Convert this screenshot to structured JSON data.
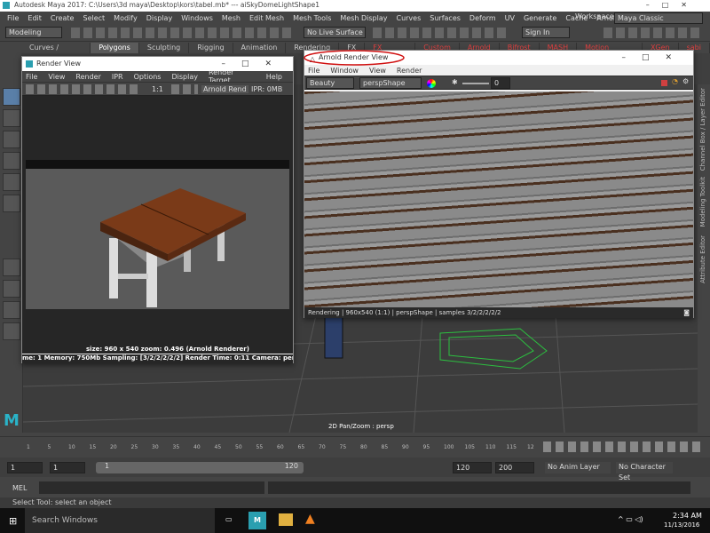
{
  "title_bar": {
    "title": "Autodesk Maya 2017: C:\\Users\\3d maya\\Desktop\\kors\\tabel.mb*    ---    aiSkyDomeLightShape1"
  },
  "menu": [
    "File",
    "Edit",
    "Create",
    "Select",
    "Modify",
    "Display",
    "Windows",
    "Mesh",
    "Edit Mesh",
    "Mesh Tools",
    "Mesh Display",
    "Curves",
    "Surfaces",
    "Deform",
    "UV",
    "Generate",
    "Cache",
    "Arnold",
    "Help"
  ],
  "workspace": {
    "label": "Workspace :",
    "value": "Maya Classic"
  },
  "status_line": {
    "mode": "Modeling",
    "live_surface": "No Live Surface",
    "sign_in": "Sign In"
  },
  "shelf_tabs": [
    "Curves / Surfaces",
    "Polygons",
    "Sculpting",
    "Rigging",
    "Animation",
    "Rendering",
    "FX",
    "FX Caching",
    "Custom",
    "Arnold",
    "Bifrost",
    "MASH",
    "Motion Graphics",
    "XGen",
    "sabi"
  ],
  "render_view": {
    "title": "Render View",
    "menu": [
      "File",
      "View",
      "Render",
      "IPR",
      "Options",
      "Display",
      "Render Target",
      "Help"
    ],
    "toolbar": {
      "ratio": "1:1",
      "renderer": "Arnold Rend",
      "ipr": "IPR: 0MB"
    },
    "size_text": "size: 960 x 540  zoom: 0.496      (Arnold Renderer)",
    "stats": "me: 1    Memory: 750Mb    Sampling: [3/2/2/2/2/2]    Render Time: 0:11    Camera: perspShape"
  },
  "arnold_view": {
    "title": "Arnold Render View",
    "menu": [
      "File",
      "Window",
      "View",
      "Render"
    ],
    "aov": "Beauty",
    "camera": "perspShape",
    "exposure": "0",
    "status": "Rendering | 960x540 (1:1) | perspShape | samples 3/2/2/2/2/2"
  },
  "viewport": {
    "hud": "2D Pan/Zoom : persp"
  },
  "right_tabs": [
    "Channel Box / Layer Editor",
    "Modeling Toolkit",
    "Attribute Editor"
  ],
  "timeline": {
    "ticks": [
      "1",
      "5",
      "10",
      "15",
      "20",
      "25",
      "30",
      "35",
      "40",
      "45",
      "50",
      "55",
      "60",
      "65",
      "70",
      "75",
      "80",
      "85",
      "90",
      "95",
      "100",
      "105",
      "110",
      "115",
      "12"
    ]
  },
  "range": {
    "start": "1",
    "start2": "1",
    "inner_start": "1",
    "inner_end": "120",
    "end": "120",
    "end2": "200",
    "anim_layer": "No Anim Layer",
    "char_set": "No Character Set"
  },
  "command_line": {
    "label": "MEL"
  },
  "help_line": "Select Tool: select an object",
  "taskbar": {
    "search": "Search Windows",
    "time": "2:34 AM",
    "date": "11/13/2016"
  }
}
